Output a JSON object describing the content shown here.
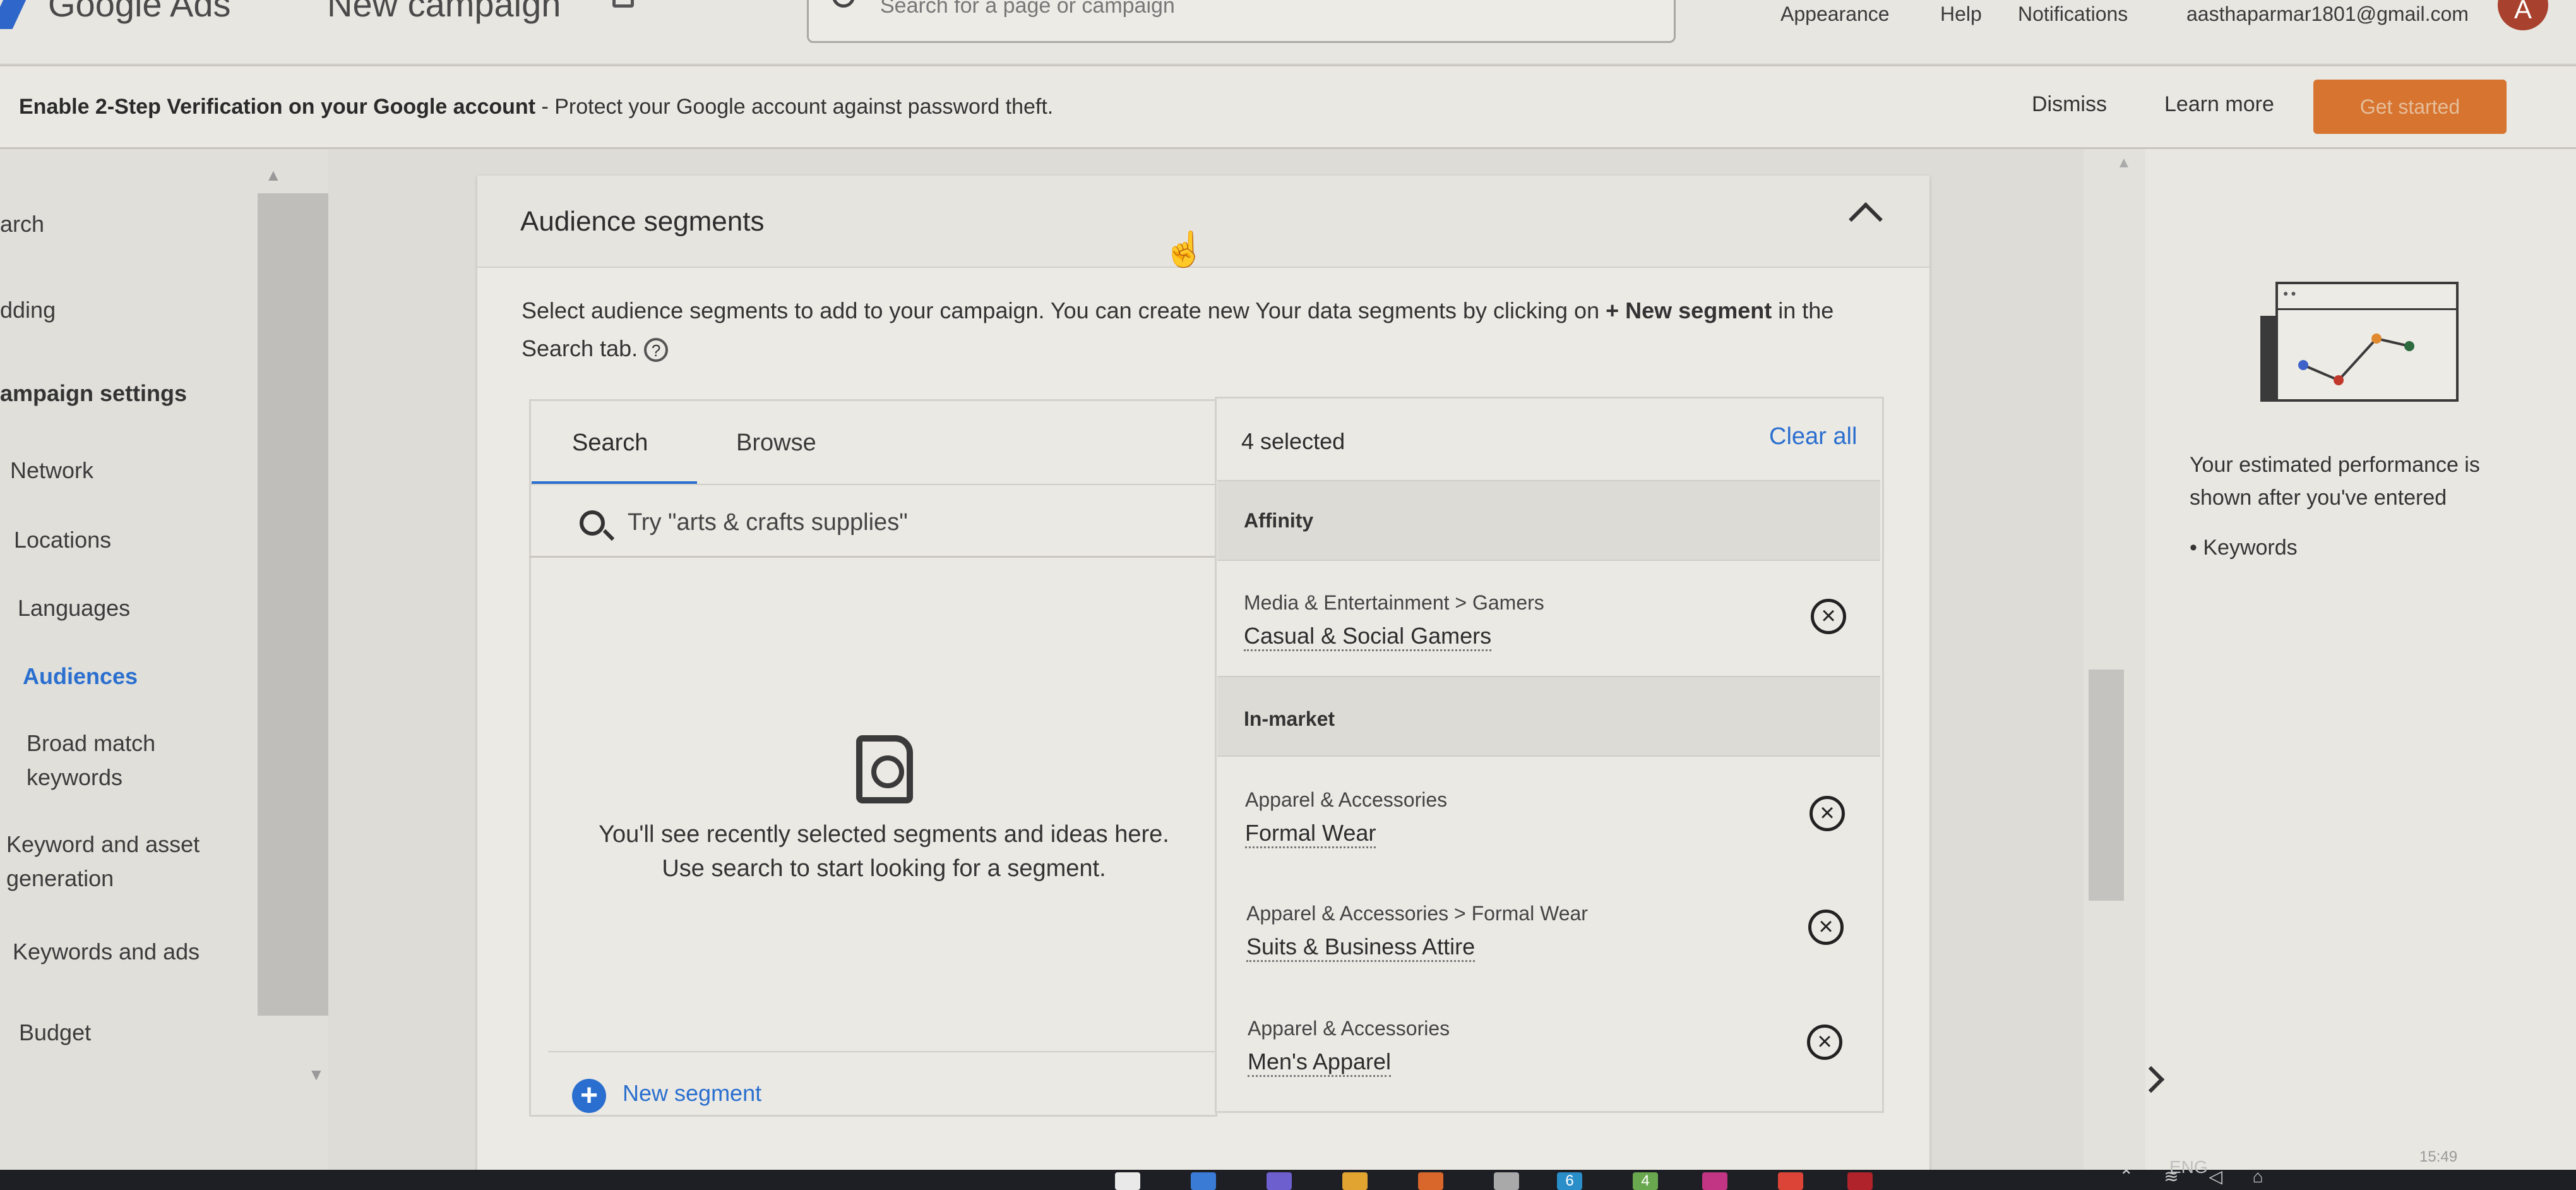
{
  "app": {
    "logo_text": "Google Ads",
    "page_title": "New campaign"
  },
  "top_search": {
    "placeholder": "Search for a page or campaign"
  },
  "top_links": [
    "Appearance",
    "Help",
    "Notifications",
    "aasthaparmar1801@gmail.com"
  ],
  "avatar_letter": "A",
  "banner": {
    "bold": "Enable 2-Step Verification on your Google account",
    "rest": " - Protect your Google account against password theft.",
    "dismiss": "Dismiss",
    "learn_more": "Learn more",
    "get_started": "Get started"
  },
  "nav": {
    "items": [
      "arch",
      "dding",
      "ampaign settings",
      "Network",
      "Locations",
      "Languages",
      "Audiences",
      "Broad match keywords",
      "Keyword and asset generation",
      "Keywords and ads",
      "Budget"
    ],
    "active": "Audiences"
  },
  "card": {
    "title": "Audience segments",
    "intro_part1": "Select audience segments to add to your campaign. You can create new Your data segments by clicking on ",
    "intro_bold": "+ New segment",
    "intro_part2": " in the Search tab.",
    "help_icon_glyph": "?"
  },
  "left_panel": {
    "tabs": [
      "Search",
      "Browse"
    ],
    "active_tab": "Search",
    "search_placeholder": "Try \"arts & crafts supplies\"",
    "empty_line1": "You'll see recently selected segments and ideas here.",
    "empty_line2": "Use search to start looking for a segment.",
    "new_segment_label": "New segment"
  },
  "right_panel": {
    "selected_count": "4 selected",
    "clear_all": "Clear all",
    "groups": [
      {
        "label": "Affinity",
        "segments": [
          {
            "path": "Media & Entertainment > Gamers",
            "name": "Casual & Social Gamers"
          }
        ]
      },
      {
        "label": "In-market",
        "segments": [
          {
            "path": "Apparel & Accessories",
            "name": "Formal Wear"
          },
          {
            "path": "Apparel & Accessories > Formal Wear",
            "name": "Suits & Business Attire"
          },
          {
            "path": "Apparel & Accessories",
            "name": "Men's Apparel"
          }
        ]
      }
    ]
  },
  "side_panel": {
    "performance_text": "Your estimated performance is shown after you've entered",
    "bullet": "Keywords",
    "chart_colors": [
      "#3d63c9",
      "#c0392b",
      "#e0892e",
      "#2d6b3f"
    ]
  },
  "taskbar": {
    "lang": "ENG",
    "time": "15:49",
    "badges": [
      "6",
      "4"
    ]
  },
  "colors": {
    "accent": "#2a6fcf",
    "cta": "#d7742f",
    "avatar": "#a8412d"
  }
}
